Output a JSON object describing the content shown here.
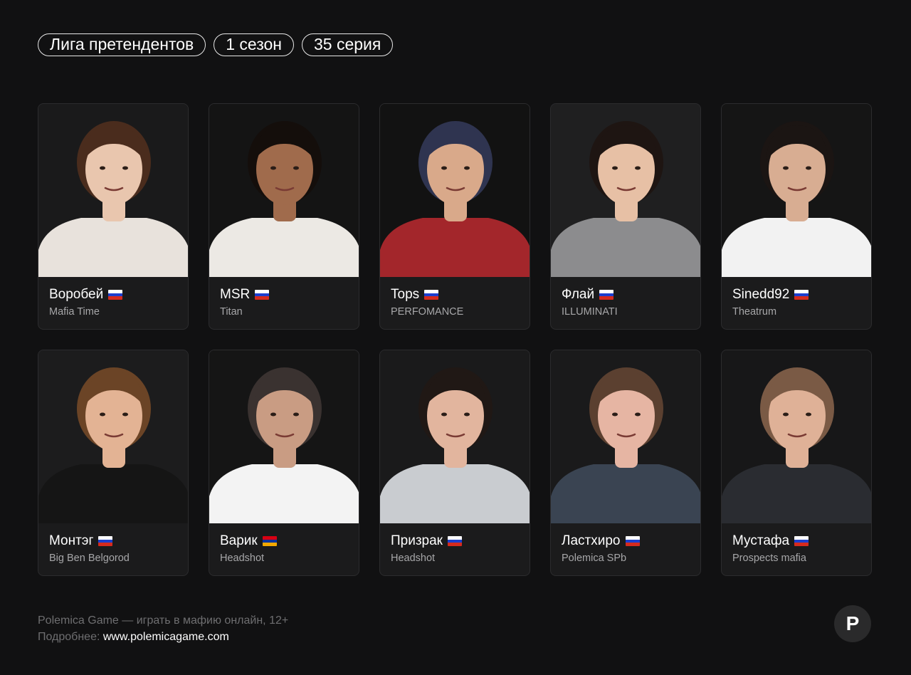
{
  "tags": [
    "Лига претендентов",
    "1 сезон",
    "35 серия"
  ],
  "players": [
    {
      "name": "Воробей",
      "team": "Mafia Time",
      "flag": "flag-russia-icon",
      "flag_colors": [
        "#ffffff",
        "#1c3ecf",
        "#d52b1e"
      ],
      "skin": "#e9c6ae",
      "hair": "#4a2c1d",
      "shirt": "#e8e2dc",
      "bg": "#1a1a1b"
    },
    {
      "name": "MSR",
      "team": "Titan",
      "flag": "flag-russia-icon",
      "flag_colors": [
        "#ffffff",
        "#1c3ecf",
        "#d52b1e"
      ],
      "skin": "#a06b4c",
      "hair": "#140e0b",
      "shirt": "#ece9e4",
      "bg": "#141414"
    },
    {
      "name": "Tops",
      "team": "PERFOMANCE",
      "flag": "flag-russia-icon",
      "flag_colors": [
        "#ffffff",
        "#1c3ecf",
        "#d52b1e"
      ],
      "skin": "#d9a98a",
      "hair": "#2f3450",
      "shirt": "#a3262b",
      "bg": "#121212"
    },
    {
      "name": "Флай",
      "team": "ILLUMINATI",
      "flag": "flag-russia-icon",
      "flag_colors": [
        "#ffffff",
        "#1c3ecf",
        "#d52b1e"
      ],
      "skin": "#e7c0a5",
      "hair": "#1e1512",
      "shirt": "#8c8c8e",
      "bg": "#1f1f20"
    },
    {
      "name": "Sinedd92",
      "team": "Theatrum",
      "flag": "flag-russia-icon",
      "flag_colors": [
        "#ffffff",
        "#1c3ecf",
        "#d52b1e"
      ],
      "skin": "#d8ad92",
      "hair": "#1b1513",
      "shirt": "#f2f2f2",
      "bg": "#151515"
    },
    {
      "name": "Монтэг",
      "team": "Big Ben Belgorod",
      "flag": "flag-russia-icon",
      "flag_colors": [
        "#ffffff",
        "#1c3ecf",
        "#d52b1e"
      ],
      "skin": "#e3b394",
      "hair": "#6b4426",
      "shirt": "#151515",
      "bg": "#1c1c1d"
    },
    {
      "name": "Варик",
      "team": "Headshot",
      "flag": "flag-armenia-icon",
      "flag_colors": [
        "#d90012",
        "#0033a0",
        "#f2a800"
      ],
      "skin": "#c99c83",
      "hair": "#3a3230",
      "shirt": "#f3f3f3",
      "bg": "#151515"
    },
    {
      "name": "Призрак",
      "team": "Headshot",
      "flag": "flag-russia-icon",
      "flag_colors": [
        "#ffffff",
        "#1c3ecf",
        "#d52b1e"
      ],
      "skin": "#e2b59e",
      "hair": "#201815",
      "shirt": "#c9ccd0",
      "bg": "#1a1a1b"
    },
    {
      "name": "Ластхиро",
      "team": "Polemica SPb",
      "flag": "flag-russia-icon",
      "flag_colors": [
        "#ffffff",
        "#1c3ecf",
        "#d52b1e"
      ],
      "skin": "#e6b5a3",
      "hair": "#5b4030",
      "shirt": "#3a4452",
      "bg": "#1a1a1b"
    },
    {
      "name": "Мустафа",
      "team": "Prospects mafia",
      "flag": "flag-russia-icon",
      "flag_colors": [
        "#ffffff",
        "#1c3ecf",
        "#d52b1e"
      ],
      "skin": "#dfb197",
      "hair": "#7a5a45",
      "shirt": "#2a2c31",
      "bg": "#171718"
    }
  ],
  "footer": {
    "line1": "Polemica Game — играть в мафию онлайн, 12+",
    "line2_label": "Подробнее:",
    "line2_link": "www.polemicagame.com"
  },
  "logo": {
    "letter": "P"
  }
}
